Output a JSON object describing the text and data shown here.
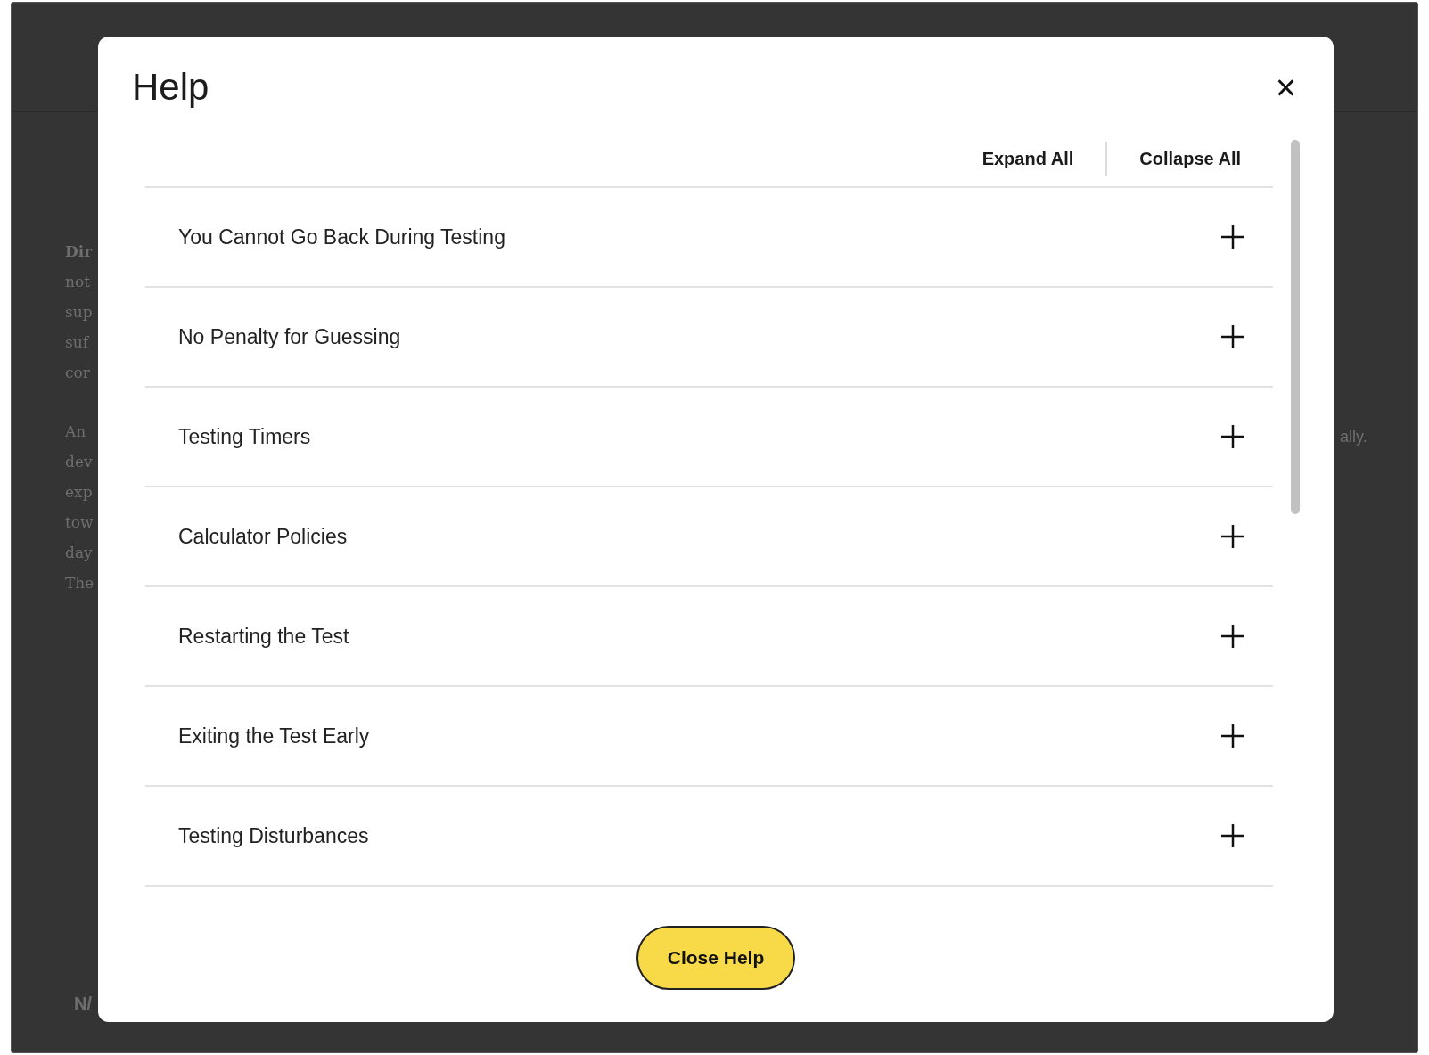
{
  "background": {
    "paragraphs": [
      [
        "Dir",
        "not",
        "sup",
        "suf",
        "cor"
      ],
      [
        "An",
        "dev",
        "exp",
        "tow",
        "day",
        "The"
      ]
    ],
    "right_fragment": "ally.",
    "footer_fragment": "N/"
  },
  "dialog": {
    "title": "Help",
    "close_label": "×",
    "expand_all": "Expand All",
    "collapse_all": "Collapse All",
    "items": [
      {
        "label": "You Cannot Go Back During Testing",
        "expanded": false
      },
      {
        "label": "No Penalty for Guessing",
        "expanded": false
      },
      {
        "label": "Testing Timers",
        "expanded": false
      },
      {
        "label": "Calculator Policies",
        "expanded": false
      },
      {
        "label": "Restarting the Test",
        "expanded": false
      },
      {
        "label": "Exiting the Test Early",
        "expanded": false
      },
      {
        "label": "Testing Disturbances",
        "expanded": false
      }
    ],
    "close_button": "Close Help"
  }
}
